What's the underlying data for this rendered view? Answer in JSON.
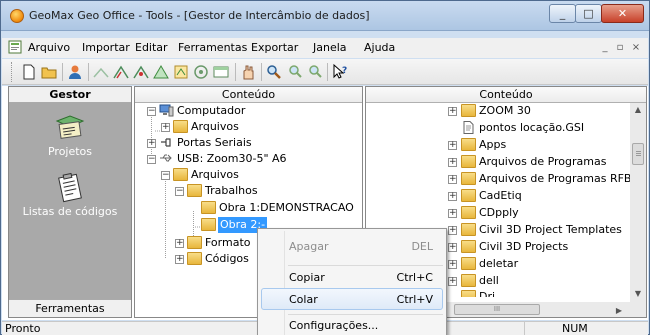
{
  "window": {
    "title": "GeoMax Geo Office - Tools - [Gestor de Intercâmbio de dados]",
    "controls": {
      "minimize": "_",
      "maximize": "□",
      "close": "✕"
    }
  },
  "menubar": {
    "items": [
      "Arquivo",
      "Importar",
      "Editar",
      "Ferramentas",
      "Exportar",
      "Janela",
      "Ajuda"
    ],
    "mdi_controls": [
      "_",
      "▫",
      "×"
    ]
  },
  "toolbar": {
    "icons": [
      "new-icon",
      "open-icon",
      "user-icon",
      "tool-1-icon",
      "tool-2-icon",
      "tool-3-icon",
      "triangle-icon",
      "tool-5-icon",
      "tool-6-icon",
      "window-icon",
      "hand-icon",
      "find-icon",
      "find-prev-icon",
      "find-next-icon",
      "help-icon"
    ]
  },
  "gestor": {
    "header": "Gestor",
    "items": [
      "Projetos",
      "Listas de códigos"
    ],
    "footer": "Ferramentas"
  },
  "left_panel": {
    "header": "Conteúdo",
    "tree": [
      {
        "label": "Computador",
        "icon": "computer-icon",
        "expander": "−"
      },
      {
        "label": "Arquivos",
        "icon": "folder-icon",
        "expander": "+"
      },
      {
        "label": "Portas Seriais",
        "icon": "serial-port-icon",
        "expander": "+"
      },
      {
        "label": "USB: Zoom30-5\" A6",
        "icon": "usb-icon",
        "expander": "−"
      },
      {
        "label": "Arquivos",
        "icon": "folder-icon",
        "expander": "−"
      },
      {
        "label": "Trabalhos",
        "icon": "folder-icon",
        "expander": "−"
      },
      {
        "label": "Obra 1:DEMONSTRACAO",
        "icon": "folder-icon",
        "expander": ""
      },
      {
        "label": "Obra 2:-",
        "icon": "folder-icon",
        "expander": ""
      },
      {
        "label": "Formato",
        "icon": "folder-icon",
        "expander": "+"
      },
      {
        "label": "Códigos",
        "icon": "folder-icon",
        "expander": "+"
      }
    ]
  },
  "right_panel": {
    "header": "Conteúdo",
    "tree": [
      {
        "label": "ZOOM 30",
        "icon": "folder-icon",
        "expander": "+"
      },
      {
        "label": "pontos locação.GSI",
        "icon": "file-icon",
        "expander": ""
      },
      {
        "label": "Apps",
        "icon": "folder-icon",
        "expander": "+"
      },
      {
        "label": "Arquivos de Programas",
        "icon": "folder-icon",
        "expander": "+"
      },
      {
        "label": "Arquivos de Programas RFB",
        "icon": "folder-icon",
        "expander": "+"
      },
      {
        "label": "CadEtiq",
        "icon": "folder-icon",
        "expander": "+"
      },
      {
        "label": "CDpply",
        "icon": "folder-icon",
        "expander": "+"
      },
      {
        "label": "Civil 3D Project Templates",
        "icon": "folder-icon",
        "expander": "+"
      },
      {
        "label": "Civil 3D Projects",
        "icon": "folder-icon",
        "expander": "+"
      },
      {
        "label": "deletar",
        "icon": "folder-icon",
        "expander": "+"
      },
      {
        "label": "dell",
        "icon": "folder-icon",
        "expander": "+"
      },
      {
        "label": "Dri",
        "icon": "folder-icon",
        "expander": "+"
      }
    ],
    "hscroll_grip": "III"
  },
  "context_menu": {
    "items": [
      {
        "label": "Apagar",
        "shortcut": "DEL",
        "state": "disabled"
      },
      {
        "label": "Copiar",
        "shortcut": "Ctrl+C",
        "state": "enabled"
      },
      {
        "label": "Colar",
        "shortcut": "Ctrl+V",
        "state": "hover"
      },
      {
        "label": "Configurações...",
        "shortcut": "",
        "state": "enabled"
      }
    ]
  },
  "statusbar": {
    "text": "Pronto",
    "num": "NUM"
  },
  "colors": {
    "selection": "#3399ff",
    "gestor_bg": "#a9a9a9",
    "title_gradient_top": "#c9dbf0",
    "close_button": "#c8412a"
  }
}
